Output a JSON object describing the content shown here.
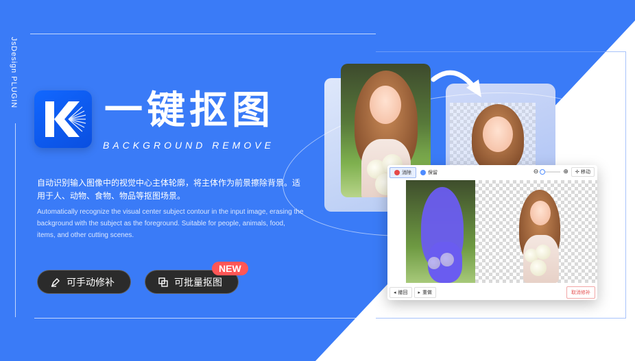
{
  "side_label": "JsDesign PLUGIN",
  "title_cn": "一键抠图",
  "title_en": "BACKGROUND REMOVE",
  "desc_cn": "自动识别输入图像中的视觉中心主体轮廓，将主体作为前景擦除背景。适用于人、动物、食物、物品等抠图场景。",
  "desc_en": "Automatically recognize the visual center subject contour in the input image, erasing the background with the subject as the foreground. Suitable for people, animals, food, items, and other cutting scenes.",
  "buttons": {
    "manual_label": "可手动修补",
    "batch_label": "可批量抠图",
    "new_badge": "NEW"
  },
  "editor": {
    "erase_label": "消除",
    "keep_label": "保留",
    "move_label": "移动",
    "undo_label": "撤回",
    "redo_label": "重做",
    "cancel_label": "取消修补"
  },
  "colors": {
    "background": "#3A7BF7",
    "accent_red": "#FF5656",
    "pill_dark": "#2B2B2B",
    "mask_purple": "#6A5CF0"
  }
}
